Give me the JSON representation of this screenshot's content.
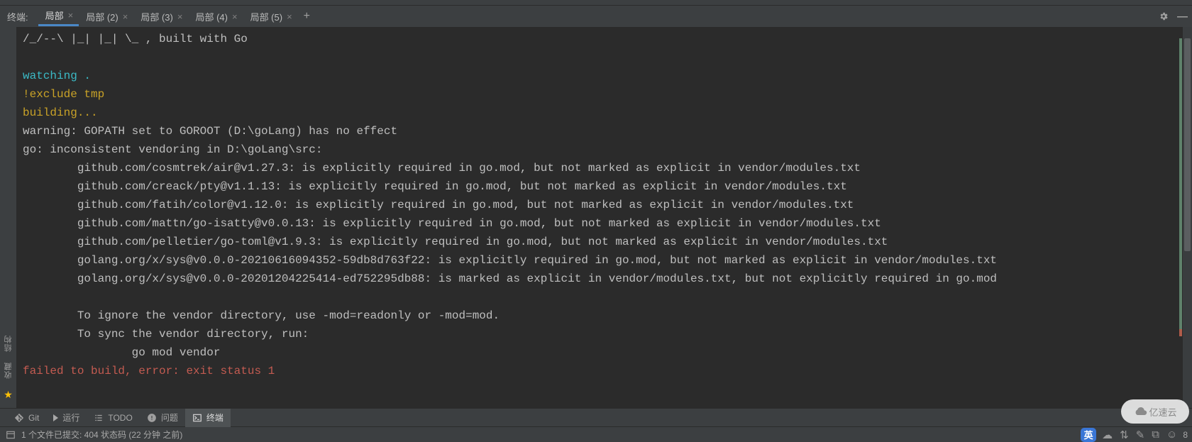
{
  "tabbar": {
    "title": "终端:",
    "tabs": [
      {
        "label": "局部",
        "active": true
      },
      {
        "label": "局部 (2)",
        "active": false
      },
      {
        "label": "局部 (3)",
        "active": false
      },
      {
        "label": "局部 (4)",
        "active": false
      },
      {
        "label": "局部 (5)",
        "active": false
      }
    ]
  },
  "terminal": {
    "lines": [
      {
        "cls": "c-gray",
        "text": "/_/--\\ |_| |_| \\_ , built with Go"
      },
      {
        "cls": "c-gray",
        "text": ""
      },
      {
        "cls": "c-cyan",
        "text": "watching ."
      },
      {
        "cls": "c-yel",
        "text": "!exclude tmp"
      },
      {
        "cls": "c-yel",
        "text": "building..."
      },
      {
        "cls": "c-gray",
        "text": "warning: GOPATH set to GOROOT (D:\\goLang) has no effect"
      },
      {
        "cls": "c-gray",
        "text": "go: inconsistent vendoring in D:\\goLang\\src:"
      },
      {
        "cls": "c-gray",
        "text": "        github.com/cosmtrek/air@v1.27.3: is explicitly required in go.mod, but not marked as explicit in vendor/modules.txt"
      },
      {
        "cls": "c-gray",
        "text": "        github.com/creack/pty@v1.1.13: is explicitly required in go.mod, but not marked as explicit in vendor/modules.txt"
      },
      {
        "cls": "c-gray",
        "text": "        github.com/fatih/color@v1.12.0: is explicitly required in go.mod, but not marked as explicit in vendor/modules.txt"
      },
      {
        "cls": "c-gray",
        "text": "        github.com/mattn/go-isatty@v0.0.13: is explicitly required in go.mod, but not marked as explicit in vendor/modules.txt"
      },
      {
        "cls": "c-gray",
        "text": "        github.com/pelletier/go-toml@v1.9.3: is explicitly required in go.mod, but not marked as explicit in vendor/modules.txt"
      },
      {
        "cls": "c-gray",
        "text": "        golang.org/x/sys@v0.0.0-20210616094352-59db8d763f22: is explicitly required in go.mod, but not marked as explicit in vendor/modules.txt"
      },
      {
        "cls": "c-gray",
        "text": "        golang.org/x/sys@v0.0.0-20201204225414-ed752295db88: is marked as explicit in vendor/modules.txt, but not explicitly required in go.mod"
      },
      {
        "cls": "c-gray",
        "text": ""
      },
      {
        "cls": "c-gray",
        "text": "        To ignore the vendor directory, use -mod=readonly or -mod=mod."
      },
      {
        "cls": "c-gray",
        "text": "        To sync the vendor directory, run:"
      },
      {
        "cls": "c-gray",
        "text": "                go mod vendor"
      },
      {
        "cls": "c-red",
        "text": "failed to build, error: exit status 1"
      }
    ]
  },
  "tools": {
    "git": "Git",
    "run": "运行",
    "todo": "TODO",
    "problems": "问题",
    "terminal": "终端"
  },
  "status": {
    "commit": "1 个文件已提交: 404 状态码 (22 分钟 之前)",
    "ime": "英",
    "col": "8"
  },
  "sidebar": {
    "structure": "结构",
    "favorites": "收藏"
  },
  "watermark": "亿速云"
}
